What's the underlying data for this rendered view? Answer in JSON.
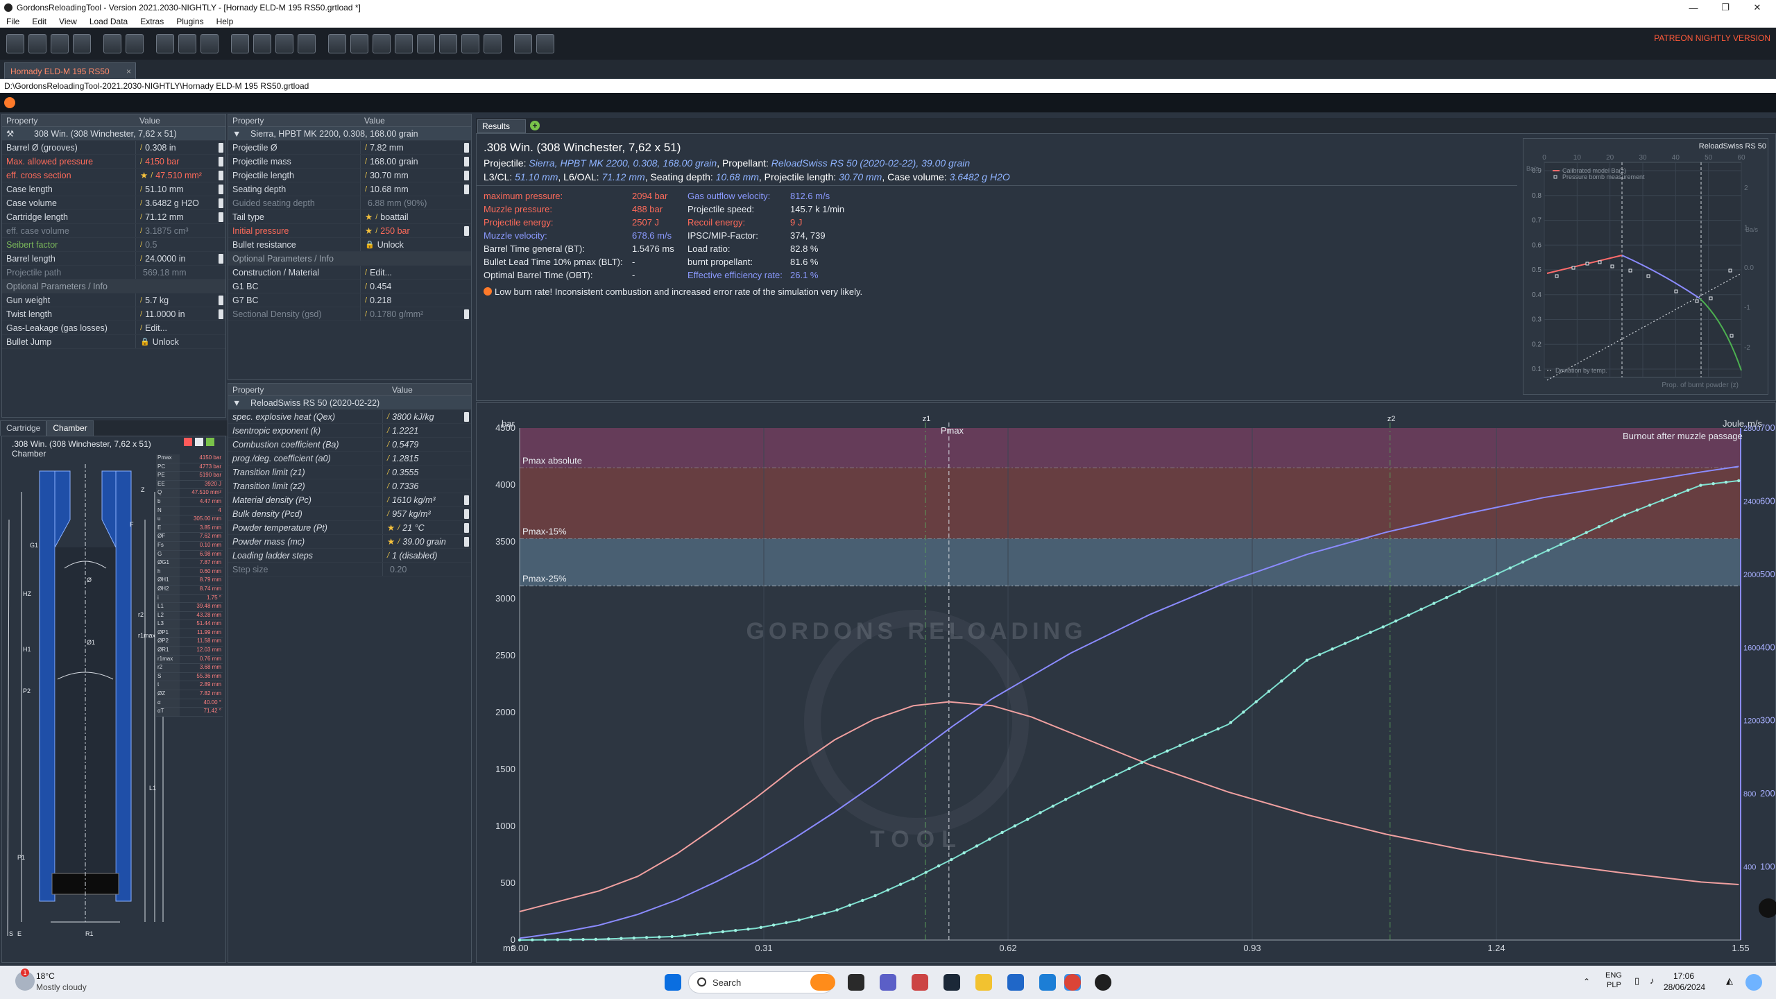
{
  "window": {
    "title": "GordonsReloadingTool - Version 2021.2030-NIGHTLY - [Hornady ELD-M 195 RS50.grtload *]"
  },
  "menu": [
    "File",
    "Edit",
    "View",
    "Load Data",
    "Extras",
    "Plugins",
    "Help"
  ],
  "patreon": "PATREON NIGHTLY VERSION",
  "doc_tab": "Hornady ELD-M 195 RS50",
  "path": "D:\\GordonsReloadingTool-2021.2030-NIGHTLY\\Hornady ELD-M 195 RS50.grtload",
  "grid_headers": {
    "property": "Property",
    "value": "Value"
  },
  "cartridge_grid": {
    "selector": "308 Win. (308 Winchester, 7,62 x 51)",
    "rows": [
      {
        "n": "Barrel Ø (grooves)",
        "v": "0.308 in"
      },
      {
        "n": "Max. allowed pressure",
        "v": "4150 bar"
      },
      {
        "n": "eff. cross section",
        "v": "47.510 mm²"
      },
      {
        "n": "Case length",
        "v": "51.10 mm"
      },
      {
        "n": "Case volume",
        "v": "3.6482 g H2O"
      },
      {
        "n": "Cartridge length",
        "v": "71.12 mm"
      },
      {
        "n": "eff. case volume",
        "v": "3.1875 cm³"
      },
      {
        "n": "Seibert factor",
        "v": "0.5"
      },
      {
        "n": "Barrel length",
        "v": "24.0000 in"
      },
      {
        "n": "Projectile path",
        "v": "569.18 mm"
      }
    ],
    "optional_header": "Optional Parameters / Info",
    "optional": [
      {
        "n": "Gun weight",
        "v": "5.7 kg"
      },
      {
        "n": "Twist length",
        "v": "11.0000 in"
      },
      {
        "n": "Gas-Leakage (gas losses)",
        "v": "Edit..."
      },
      {
        "n": "Bullet Jump",
        "v": "Unlock"
      }
    ]
  },
  "projectile_grid": {
    "selector": "Sierra, HPBT MK 2200, 0.308, 168.00 grain",
    "rows": [
      {
        "n": "Projectile Ø",
        "v": "7.82 mm"
      },
      {
        "n": "Projectile mass",
        "v": "168.00 grain"
      },
      {
        "n": "Projectile length",
        "v": "30.70 mm"
      },
      {
        "n": "Seating depth",
        "v": "10.68 mm"
      },
      {
        "n": "Guided seating depth",
        "v": "6.88 mm (90%)"
      },
      {
        "n": "Tail type",
        "v": "boattail"
      },
      {
        "n": "Initial pressure",
        "v": "250 bar"
      },
      {
        "n": "Bullet resistance",
        "v": "Unlock"
      }
    ],
    "optional_header": "Optional Parameters / Info",
    "optional": [
      {
        "n": "Construction / Material",
        "v": "Edit..."
      },
      {
        "n": "G1 BC",
        "v": "0.454"
      },
      {
        "n": "G7 BC",
        "v": "0.218"
      },
      {
        "n": "Sectional Density (gsd)",
        "v": "0.1780 g/mm²"
      }
    ]
  },
  "powder_grid": {
    "selector": "ReloadSwiss RS 50 (2020-02-22)",
    "rows": [
      {
        "n": "spec. explosive heat (Qex)",
        "v": "3800 kJ/kg"
      },
      {
        "n": "Isentropic exponent (k)",
        "v": "1.2221"
      },
      {
        "n": "Combustion coefficient (Ba)",
        "v": "0.5479"
      },
      {
        "n": "prog./deg. coefficient (a0)",
        "v": "1.2815"
      },
      {
        "n": "Transition limit (z1)",
        "v": "0.3555"
      },
      {
        "n": "Transition limit (z2)",
        "v": "0.7336"
      },
      {
        "n": "Material density (Pc)",
        "v": "1610 kg/m³"
      },
      {
        "n": "Bulk density (Pcd)",
        "v": "957 kg/m³"
      },
      {
        "n": "Powder temperature (Pt)",
        "v": "21 °C"
      },
      {
        "n": "Powder mass (mc)",
        "v": "39.00 grain"
      },
      {
        "n": "Loading ladder steps",
        "v": "1 (disabled)"
      },
      {
        "n": "Step size",
        "v": "0.20"
      }
    ]
  },
  "cartridge_tabs": [
    "Cartridge",
    "Chamber"
  ],
  "drawing": {
    "title": ".308 Win. (308 Winchester, 7,62 x 51)",
    "subtitle": "Chamber",
    "dims": [
      {
        "k": "Pmax",
        "v": "4150 bar"
      },
      {
        "k": "PC",
        "v": "4773 bar"
      },
      {
        "k": "PE",
        "v": "5190 bar"
      },
      {
        "k": "EE",
        "v": "3920 J"
      },
      {
        "k": "Q",
        "v": "47.510 mm²"
      },
      {
        "k": "b",
        "v": "4.47 mm"
      },
      {
        "k": "N",
        "v": "4"
      },
      {
        "k": "u",
        "v": "305.00 mm"
      },
      {
        "k": "E",
        "v": "3.85 mm"
      },
      {
        "k": "ØF",
        "v": "7.62 mm"
      },
      {
        "k": "Fs",
        "v": "0.10 mm"
      },
      {
        "k": "G",
        "v": "6.98 mm"
      },
      {
        "k": "ØG1",
        "v": "7.87 mm"
      },
      {
        "k": "h",
        "v": "0.60 mm"
      },
      {
        "k": "ØH1",
        "v": "8.79 mm"
      },
      {
        "k": "ØH2",
        "v": "8.74 mm"
      },
      {
        "k": "i",
        "v": "1.75 °"
      },
      {
        "k": "L1",
        "v": "39.48 mm"
      },
      {
        "k": "L2",
        "v": "43.28 mm"
      },
      {
        "k": "L3",
        "v": "51.44 mm"
      },
      {
        "k": "ØP1",
        "v": "11.99 mm"
      },
      {
        "k": "ØP2",
        "v": "11.58 mm"
      },
      {
        "k": "ØR1",
        "v": "12.03 mm"
      },
      {
        "k": "r1max",
        "v": "0.76 mm"
      },
      {
        "k": "r2",
        "v": "3.68 mm"
      },
      {
        "k": "S",
        "v": "55.36 mm"
      },
      {
        "k": "t",
        "v": "2.89 mm"
      },
      {
        "k": "ØZ",
        "v": "7.82 mm"
      },
      {
        "k": "α",
        "v": "40.00 °"
      },
      {
        "k": "αT",
        "v": "71.42 °"
      }
    ],
    "labels": [
      "G1",
      "HZ",
      "H1",
      "P2",
      "P1",
      "F",
      "E",
      "R1",
      "L1",
      "S",
      "Z",
      "r2",
      "r1max",
      "Ø",
      "Ø1"
    ]
  },
  "results": {
    "tab": "Results",
    "title": ".308 Win. (308 Winchester, 7,62 x 51)",
    "line1_pre": "Projectile: ",
    "line1_proj": "Sierra, HPBT MK 2200, 0.308, 168.00 grain",
    "line1_mid": ", Propellant: ",
    "line1_prop": "ReloadSwiss RS 50 (2020-02-22), 39.00 grain",
    "line2_a": "L3/CL: ",
    "line2_av": "51.10 mm",
    "line2_b": ", L6/OAL: ",
    "line2_bv": "71.12 mm",
    "line2_c": ", Seating depth: ",
    "line2_cv": "10.68 mm",
    "line2_d": ", Projectile length: ",
    "line2_dv": "30.70 mm",
    "line2_e": ", Case volume: ",
    "line2_ev": "3.6482 g H2O",
    "left": [
      {
        "k": "maximum pressure:",
        "v": "2094 bar",
        "c": "red"
      },
      {
        "k": "Muzzle pressure:",
        "v": "488 bar",
        "c": "red"
      },
      {
        "k": "Projectile energy:",
        "v": "2507 J",
        "c": "red"
      },
      {
        "k": "Muzzle velocity:",
        "v": "678.6 m/s",
        "c": "blue"
      },
      {
        "k": "Barrel Time general (BT):",
        "v": "1.5476 ms",
        "c": "white"
      },
      {
        "k": "Bullet Lead Time 10% pmax (BLT):",
        "v": "-",
        "c": "white"
      },
      {
        "k": "Optimal Barrel Time (OBT):",
        "v": "-",
        "c": "white"
      }
    ],
    "right": [
      {
        "k": "Gas outflow velocity:",
        "v": "812.6 m/s",
        "c": "blue"
      },
      {
        "k": "Projectile speed:",
        "v": "145.7 k 1/min",
        "c": "white"
      },
      {
        "k": "Recoil energy:",
        "v": "9 J",
        "c": "red"
      },
      {
        "k": "IPSC/MIP-Factor:",
        "v": "374, 739",
        "c": "white"
      },
      {
        "k": "Load ratio:",
        "v": "82.8 %",
        "c": "white"
      },
      {
        "k": "burnt propellant:",
        "v": "81.6 %",
        "c": "white"
      },
      {
        "k": "Effective efficiency rate:",
        "v": "26.1 %",
        "c": "blue"
      }
    ],
    "warning": "Low burn rate! Inconsistent combustion and increased error rate of the simulation very likely."
  },
  "mini_chart": {
    "title": "ReloadSwiss RS 50",
    "legend": [
      "Calibrated model Ba(z)",
      "Pressure bomb measurement"
    ],
    "xlabel": "Prop. of burnt powder (z)",
    "bottom_legend": "Deviation by temp.",
    "left_axis_label": "Ba/s",
    "right_axis_label": "Ba/s",
    "x_ticks": [
      "0",
      "10",
      "20",
      "30",
      "40",
      "50",
      "60"
    ],
    "y_ticks": [
      "0.9",
      "0.8",
      "0.7",
      "0.6",
      "0.5",
      "0.4",
      "0.3",
      "0.2",
      "0.1"
    ],
    "right_ticks": [
      "2",
      "1",
      "0.0",
      "-1",
      "-2"
    ],
    "colors": {
      "calibrated": "#ff6b6b",
      "model": "#8b8bff",
      "green": "#4caf50",
      "dotted": "#cfd4da"
    }
  },
  "chart_data": {
    "type": "line",
    "xlabel": "ms",
    "ylabel": "bar",
    "y2label": "Joule",
    "y3label": "m/s",
    "xlim": [
      0,
      1.55
    ],
    "ylim": [
      0,
      4500
    ],
    "y2lim": [
      0,
      2800
    ],
    "y3lim": [
      0,
      700
    ],
    "x_ticks": [
      0.0,
      0.31,
      0.62,
      0.93,
      1.24,
      1.55
    ],
    "x_tick_labels": [
      "0.00",
      "0.31",
      "0.62",
      "0.93",
      "1.24",
      "1.55"
    ],
    "y_ticks": [
      0,
      500,
      1000,
      1500,
      2000,
      2500,
      3000,
      3500,
      4000,
      4500
    ],
    "y2_ticks": [
      400,
      800,
      1200,
      1600,
      2000,
      2400,
      2800
    ],
    "y3_ticks": [
      100,
      200,
      300,
      400,
      500,
      600,
      700
    ],
    "markers": [
      {
        "label": "z1",
        "x": 0.515
      },
      {
        "label": "Pmax",
        "x": 0.545
      },
      {
        "label": "z2",
        "x": 1.105
      }
    ],
    "bands": [
      {
        "label": "Pmax absolute",
        "from": 4150,
        "to": 4500,
        "color": "#6b3d5c"
      },
      {
        "label": "Pmax-15%",
        "from": 3527,
        "to": 4150,
        "color": "#6e3f41"
      },
      {
        "label": "Pmax-25%",
        "from": 3112,
        "to": 3527,
        "color": "#4c6478"
      }
    ],
    "annotation": "Burnout after muzzle passage",
    "series": [
      {
        "axis": "y",
        "color": "#f0a0a0",
        "x": [
          0,
          0.05,
          0.1,
          0.15,
          0.2,
          0.25,
          0.3,
          0.35,
          0.4,
          0.45,
          0.5,
          0.545,
          0.6,
          0.65,
          0.7,
          0.8,
          0.9,
          1.0,
          1.1,
          1.2,
          1.3,
          1.4,
          1.5,
          1.5476
        ],
        "values": [
          250,
          340,
          430,
          560,
          760,
          1000,
          1250,
          1520,
          1760,
          1940,
          2060,
          2094,
          2060,
          1960,
          1820,
          1540,
          1300,
          1100,
          930,
          790,
          680,
          590,
          510,
          488
        ]
      },
      {
        "axis": "y2",
        "color": "#8b8bff",
        "x": [
          0,
          0.05,
          0.1,
          0.15,
          0.2,
          0.25,
          0.3,
          0.35,
          0.4,
          0.45,
          0.5,
          0.55,
          0.6,
          0.7,
          0.8,
          0.9,
          1.0,
          1.1,
          1.2,
          1.3,
          1.4,
          1.5,
          1.5476
        ],
        "values": [
          10,
          40,
          80,
          140,
          220,
          320,
          430,
          560,
          700,
          850,
          1010,
          1170,
          1320,
          1570,
          1780,
          1960,
          2110,
          2230,
          2330,
          2420,
          2490,
          2560,
          2590
        ]
      },
      {
        "axis": "y3",
        "color": "#7fe0d0",
        "dots": true,
        "x": [
          0,
          0.1,
          0.2,
          0.3,
          0.35,
          0.4,
          0.45,
          0.5,
          0.55,
          0.6,
          0.65,
          0.7,
          0.8,
          0.9,
          1.0,
          1.1,
          1.2,
          1.3,
          1.4,
          1.5,
          1.5476
        ],
        "values": [
          0,
          1,
          5,
          16,
          26,
          40,
          60,
          84,
          111,
          140,
          168,
          196,
          248,
          295,
          383,
          430,
          480,
          530,
          580,
          622,
          628
        ]
      }
    ]
  },
  "taskbar": {
    "weather_temp": "18°C",
    "weather_desc": "Mostly cloudy",
    "search": "Search",
    "lang1": "ENG",
    "lang2": "PLP",
    "time": "17:06",
    "date": "28/06/2024"
  },
  "watermark": {
    "top": "GORDONS RELOADING",
    "bottom": "TOOL"
  }
}
